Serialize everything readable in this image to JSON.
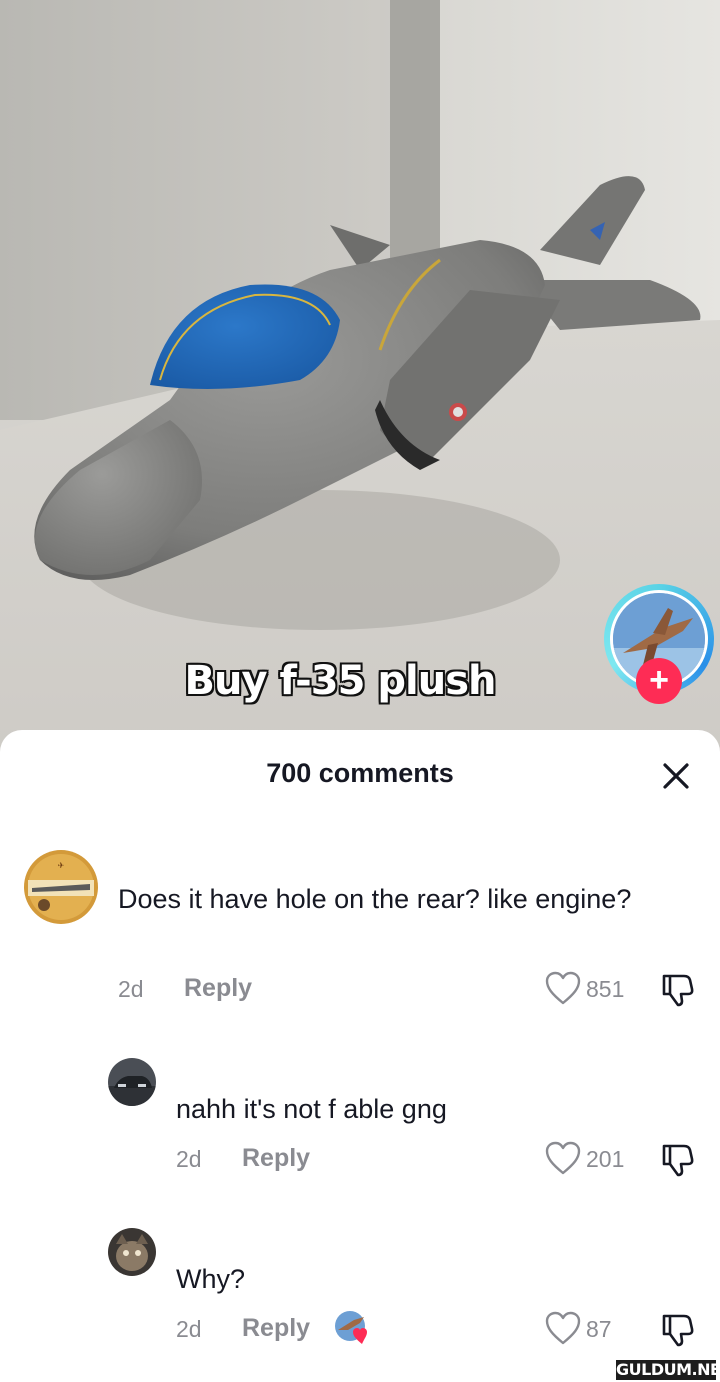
{
  "video": {
    "caption": "Buy f-35 plush"
  },
  "creator": {
    "follow_label": "+"
  },
  "comments_sheet": {
    "title": "700 comments",
    "comments": [
      {
        "text": "Does it have hole on the rear? like engine?",
        "time": "2d",
        "reply_label": "Reply",
        "likes": "851"
      },
      {
        "text": "nahh it's not f able gng",
        "time": "2d",
        "reply_label": "Reply",
        "likes": "201"
      },
      {
        "text": "Why?",
        "time": "2d",
        "reply_label": "Reply",
        "likes": "87"
      }
    ]
  },
  "watermark": "GULDUM.NET",
  "icons": {
    "close": "close-icon",
    "like": "heart-outline-icon",
    "dislike": "thumbs-down-icon",
    "creator_liked": "heart-filled-icon"
  },
  "colors": {
    "follow_accent": "#fe2c55",
    "avatar_ring": "#2a8fe8",
    "meta_text": "#8a8b91",
    "body_text": "#161823"
  }
}
